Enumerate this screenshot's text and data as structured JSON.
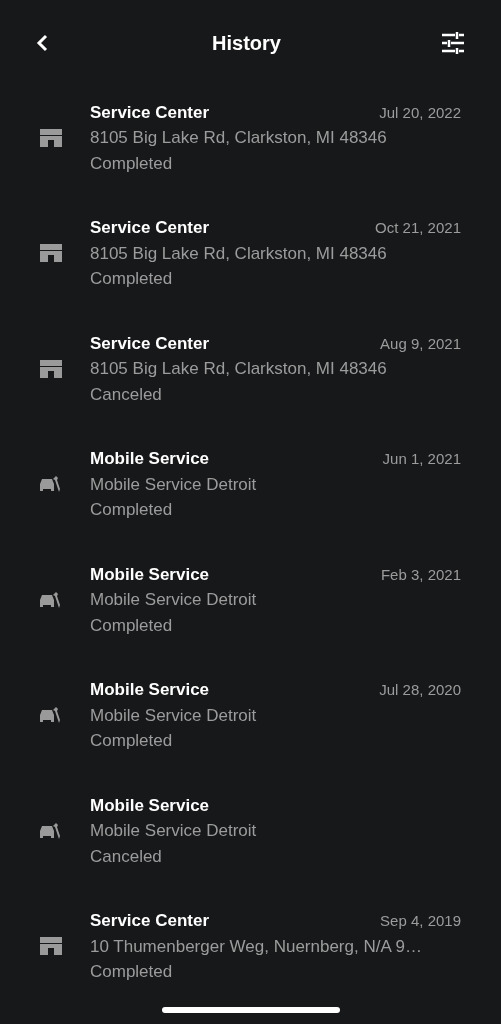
{
  "header": {
    "title": "History"
  },
  "items": [
    {
      "kind": "service_center",
      "title": "Service Center",
      "date": "Jul 20, 2022",
      "location": "8105 Big Lake Rd, Clarkston, MI 48346",
      "status": "Completed"
    },
    {
      "kind": "service_center",
      "title": "Service Center",
      "date": "Oct 21, 2021",
      "location": "8105 Big Lake Rd, Clarkston, MI 48346",
      "status": "Completed"
    },
    {
      "kind": "service_center",
      "title": "Service Center",
      "date": "Aug 9, 2021",
      "location": "8105 Big Lake Rd, Clarkston, MI 48346",
      "status": "Canceled"
    },
    {
      "kind": "mobile",
      "title": "Mobile Service",
      "date": "Jun 1, 2021",
      "location": "Mobile Service Detroit",
      "status": "Completed"
    },
    {
      "kind": "mobile",
      "title": "Mobile Service",
      "date": "Feb 3, 2021",
      "location": "Mobile Service Detroit",
      "status": "Completed"
    },
    {
      "kind": "mobile",
      "title": "Mobile Service",
      "date": "Jul 28, 2020",
      "location": "Mobile Service Detroit",
      "status": "Completed"
    },
    {
      "kind": "mobile",
      "title": "Mobile Service",
      "location": "Mobile Service Detroit",
      "status": "Canceled"
    },
    {
      "kind": "service_center",
      "title": "Service Center",
      "date": "Sep 4, 2019",
      "location": "10 Thumenberger Weg, Nuernberg, N/A 9…",
      "status": "Completed"
    }
  ]
}
